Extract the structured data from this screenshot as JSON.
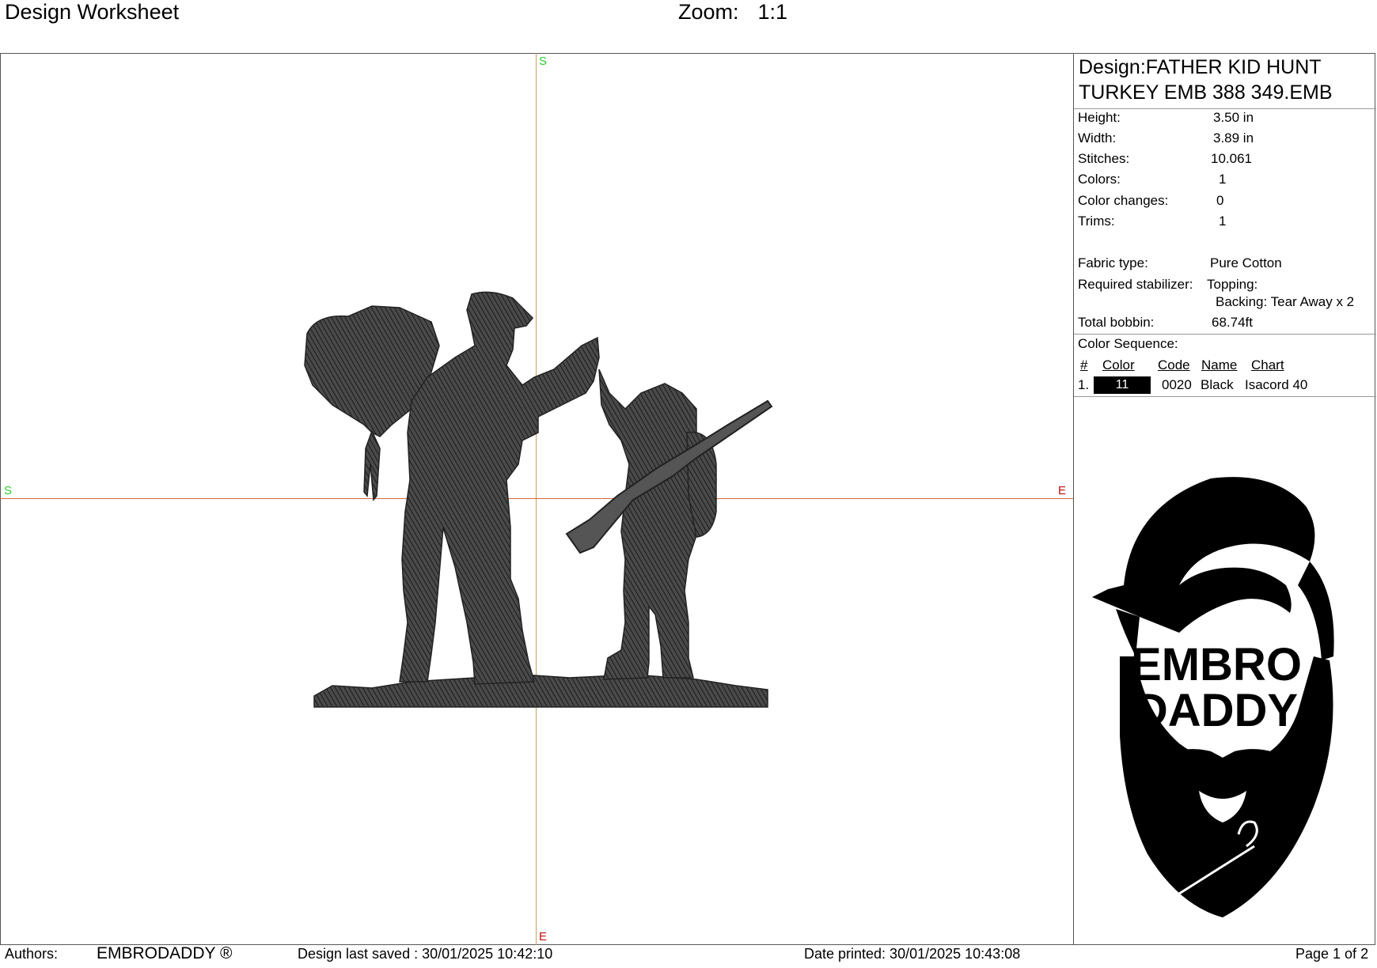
{
  "header": {
    "title": "Design Worksheet",
    "zoom_label": "Zoom:",
    "zoom_value": "1:1"
  },
  "canvas": {
    "markers": {
      "top": "S",
      "left": "S",
      "right": "E",
      "bottom": "E"
    },
    "colors": {
      "vertical_axis": "#c8a060",
      "horizontal_axis": "#d2693a",
      "s_marker": "#2ecc2e",
      "e_marker": "#c01010",
      "stitch": "#3a3a3a"
    }
  },
  "info": {
    "design_title": "Design:FATHER KID HUNT TURKEY EMB 388 349.EMB",
    "height_label": "Height:",
    "height": "3.50 in",
    "width_label": "Width:",
    "width": "3.89 in",
    "stitches_label": "Stitches:",
    "stitches": "10.061",
    "colors_label": "Colors:",
    "colors": "1",
    "color_changes_label": "Color changes:",
    "color_changes": "0",
    "trims_label": "Trims:",
    "trims": "1",
    "fabric_label": "Fabric type:",
    "fabric": "Pure Cotton",
    "stabilizer_label": "Required stabilizer:",
    "topping": "Topping:",
    "backing": "Backing: Tear Away x 2",
    "bobbin_label": "Total bobbin:",
    "bobbin": "68.74ft"
  },
  "color_sequence": {
    "title": "Color Sequence:",
    "headers": [
      "#",
      "Color",
      "Code",
      "Name",
      "Chart"
    ],
    "rows": [
      {
        "num": "1.",
        "color": "11",
        "code": "0020",
        "name": "Black",
        "chart": "Isacord 40",
        "swatch": "#000000"
      }
    ]
  },
  "logo": {
    "line1": "EMBRO",
    "line2": "DADDY"
  },
  "footer": {
    "authors_label": "Authors:",
    "authors": "EMBRODADDY ®",
    "last_saved": "Design last saved : 30/01/2025 10:42:10",
    "printed": "Date printed: 30/01/2025 10:43:08",
    "page": "Page 1 of 2"
  }
}
